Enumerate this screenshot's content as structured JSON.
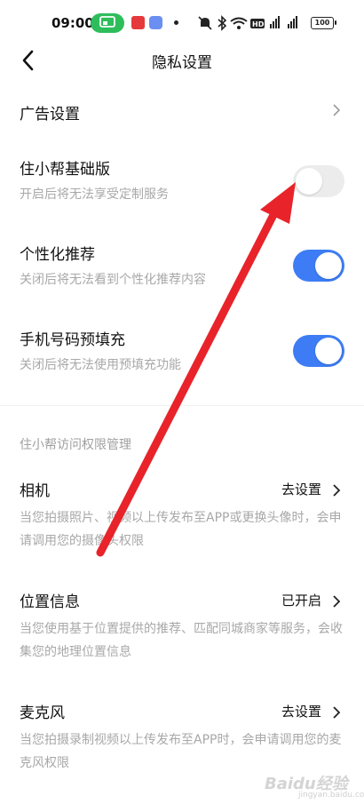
{
  "status_bar": {
    "time": "09:00",
    "battery": "100",
    "icons": [
      "screen-cast-icon",
      "app-icon",
      "app-icon",
      "notification-dot-icon",
      "mute-icon",
      "bluetooth-icon",
      "wifi-icon",
      "hd-icon",
      "4g-signal-icon",
      "5g-signal-icon",
      "battery-icon"
    ]
  },
  "nav": {
    "title": "隐私设置",
    "back_icon": "chevron-left-icon"
  },
  "settings": {
    "ad": {
      "title": "广告设置"
    },
    "basic_version": {
      "title": "住小帮基础版",
      "subtitle": "开启后将无法享受定制服务",
      "enabled": false
    },
    "personalized": {
      "title": "个性化推荐",
      "subtitle": "关闭后将无法看到个性化推荐内容",
      "enabled": true
    },
    "prefill": {
      "title": "手机号码预填充",
      "subtitle": "关闭后将无法使用预填充功能",
      "enabled": true
    }
  },
  "permissions": {
    "section_title": "住小帮访问权限管理",
    "camera": {
      "title": "相机",
      "status": "去设置",
      "description": "当您拍摄照片、视频以上传发布至APP或更换头像时，会申请调用您的摄像头权限"
    },
    "location": {
      "title": "位置信息",
      "status": "已开启",
      "description": "当您使用基于位置提供的推荐、匹配同城商家等服务，会收集您的地理位置信息"
    },
    "microphone": {
      "title": "麦克风",
      "status": "去设置",
      "description": "当您拍摄录制视频以上传发布至APP时，会申请调用您的麦克风权限"
    }
  },
  "annotation": {
    "color": "#e8232a"
  },
  "watermark": {
    "text": "Baidu经验",
    "sub": "jingyan.baidu.com"
  },
  "colors": {
    "toggle_on": "#3d7cf4",
    "toggle_off": "#ececec",
    "cast_pill": "#2ebd5b"
  }
}
